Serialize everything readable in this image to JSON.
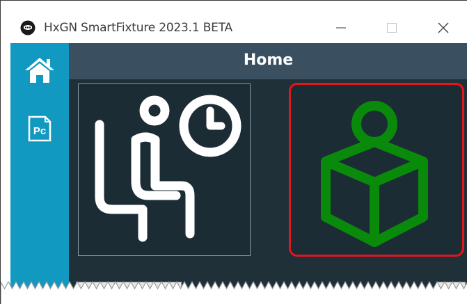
{
  "window": {
    "title": "HxGN SmartFixture 2023.1 BETA",
    "app_icon": "smartfixture-logo-icon",
    "controls": [
      "minimize-icon",
      "maximize-icon",
      "close-icon"
    ]
  },
  "sidebar": {
    "items": [
      {
        "name": "home",
        "icon": "home-icon"
      },
      {
        "name": "pc",
        "icon": "pc-icon",
        "label": "Pc"
      }
    ]
  },
  "header": {
    "title": "Home"
  },
  "tiles": [
    {
      "name": "waiting",
      "icon": "person-waiting-clock-icon",
      "color": "#ffffff",
      "highlighted": false
    },
    {
      "name": "learning",
      "icon": "person-reading-book-icon",
      "color": "#0a8a0a",
      "highlighted": true,
      "highlight_color": "#e3151d"
    }
  ],
  "colors": {
    "sidebar": "#1199c1",
    "main_bg": "#1f3039",
    "header_bg": "#3a5060",
    "highlight": "#e3151d",
    "learning_icon": "#0a8a0a"
  }
}
